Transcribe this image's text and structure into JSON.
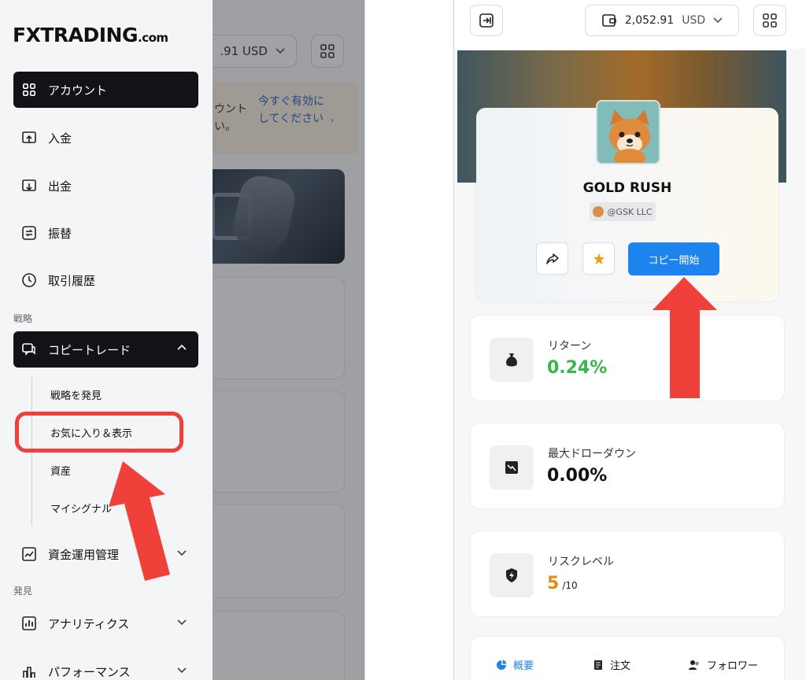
{
  "left": {
    "logo": {
      "brand": "FXTRADING",
      "suffix": ".com"
    },
    "background": {
      "balance": ".91  USD",
      "notice_left": "ウント い。",
      "notice_link": "今すぐ有効にしてください",
      "notice_arrow": "›"
    },
    "nav": {
      "account": "アカウント",
      "deposit": "入金",
      "withdraw": "出金",
      "transfer": "振替",
      "history": "取引履歴",
      "section_strategy": "戦略",
      "copytrade": "コピートレード",
      "sub_items": [
        "戦略を発見",
        "お気に入り＆表示",
        "資産",
        "マイシグナル"
      ],
      "fund_management": "資金運用管理",
      "section_discover": "発見",
      "analytics": "アナリティクス",
      "performance": "パフォーマンス"
    },
    "highlight_color": "#f0403a"
  },
  "right": {
    "balance": {
      "amount": "2,052.91",
      "currency": "USD"
    },
    "profile": {
      "name": "GOLD RUSH",
      "handle": "@GSK LLC",
      "copy_button": "コピー開始"
    },
    "stats": [
      {
        "label": "リターン",
        "value": "0.24%",
        "sub": ""
      },
      {
        "label": "最大ドローダウン",
        "value": "0.00%",
        "sub": ""
      },
      {
        "label": "リスクレベル",
        "value": "5",
        "sub": "/10"
      }
    ],
    "tabs": [
      "概要",
      "注文",
      "フォロワー"
    ],
    "colors": {
      "accent": "#1d84ee",
      "return_green": "#36b84c",
      "risk_orange": "#e88a12"
    }
  }
}
